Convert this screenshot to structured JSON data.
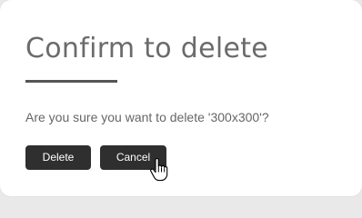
{
  "dialog": {
    "title": "Confirm to delete",
    "message": "Are you sure you want to delete '300x300'?",
    "buttons": {
      "delete_label": "Delete",
      "cancel_label": "Cancel"
    }
  },
  "cursor": {
    "icon": "hand-pointer-icon"
  },
  "colors": {
    "background": "#ffffff",
    "title_text": "#6b6b6b",
    "underline": "#555555",
    "message_text": "#666666",
    "button_bg": "#2f2f2f",
    "button_text": "#ffffff"
  }
}
